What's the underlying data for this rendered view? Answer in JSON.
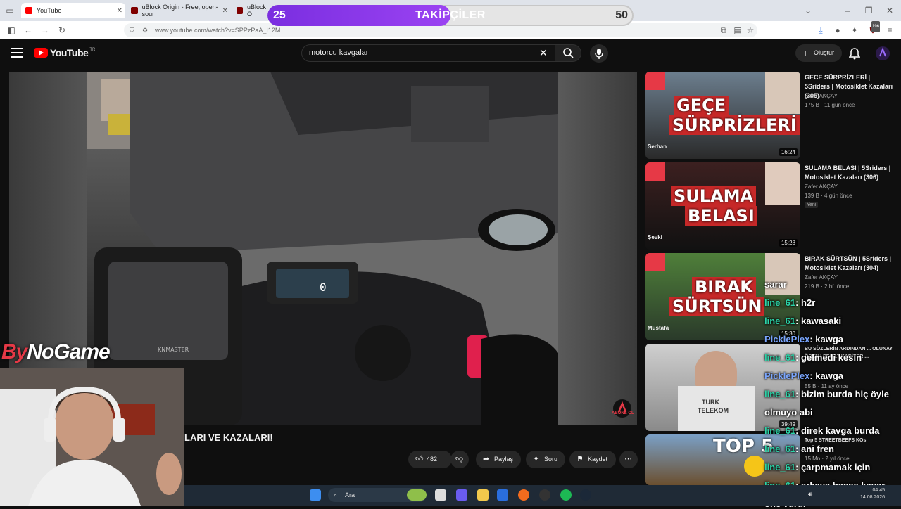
{
  "browser": {
    "tabs": [
      {
        "title": "YouTube",
        "color": "#ff0000"
      },
      {
        "title": "uBlock Origin - Free, open-sour",
        "color": "#800000"
      },
      {
        "title": "uBlock O",
        "color": "#800000"
      }
    ],
    "url": "www.youtube.com/watch?v=SPPzPaA_I12M",
    "extension_badge": "196"
  },
  "overlay": {
    "followers": {
      "label": "TAKİPÇİLER",
      "min": "25",
      "max": "50",
      "progress": 0.5
    }
  },
  "youtube": {
    "logo": "YouTube",
    "logo_sup": "TR",
    "search": {
      "query": "motorcu kavgalar"
    },
    "create_label": "Oluştur"
  },
  "video": {
    "title_visible": "LARI VE KAZALARI!",
    "actions": {
      "likes": "482",
      "share": "Paylaş",
      "ask": "Soru",
      "save": "Kaydet"
    },
    "subscribe_watermark": "ABONE OL"
  },
  "recommendations": [
    {
      "title": "GECE SÜRPRİZLERİ | 5Sriders | Motosiklet Kazaları (305)",
      "channel": "Zafer AKÇAY",
      "meta": "175 B · 11 gün önce",
      "duration": "16:24",
      "thumb_text": [
        "GEÇE",
        "SÜRPRİZLERİ"
      ],
      "thumb_name": "Serhan",
      "badge": ""
    },
    {
      "title": "SULAMA BELASI | 5Sriders | Motosiklet Kazaları (306)",
      "channel": "Zafer AKÇAY",
      "meta": "139 B · 4 gün önce",
      "duration": "15:28",
      "thumb_text": [
        "SULAMA",
        "BELASI"
      ],
      "thumb_name": "Şevki",
      "badge": "Yeni"
    },
    {
      "title": "BIRAK SÜRTSÜN | 5Sriders | Motosiklet Kazaları (304)",
      "channel": "Zafer AKÇAY",
      "meta": "219 B · 2 hf. önce",
      "duration": "15:30",
      "thumb_text": [
        "BIRAK",
        "SÜRTSÜN"
      ],
      "thumb_name": "Mustafa",
      "badge": ""
    },
    {
      "title": "BU SÖZLERİN ARDINDAN ... OLUNAY ÖREN | PES 17 KARİYER ...",
      "channel": "",
      "meta": "55 B · 11 ay önce",
      "duration": "39:49",
      "thumb_text": [
        "TÜRK",
        "TELEKOM"
      ],
      "thumb_name": "",
      "badge": ""
    },
    {
      "title": "Top 5 STREETBEEFS KOs",
      "channel": "",
      "meta": "15 Mn · 2 yıl önce",
      "duration": "",
      "thumb_text": [
        "TOP 5"
      ],
      "thumb_name": "",
      "badge": ""
    }
  ],
  "chat": [
    {
      "user": "",
      "msg": "sarar"
    },
    {
      "user": "line_61",
      "msg": ": h2r"
    },
    {
      "user": "line_61",
      "msg": ": kawasaki"
    },
    {
      "user": "PicklePlex",
      "msg": ": kawga"
    },
    {
      "user": "line_61",
      "msg": ": gelmedi kesin"
    },
    {
      "user": "PicklePlex",
      "msg": ": kawga"
    },
    {
      "user": "line_61",
      "msg": ": bizim burda hiç öyle"
    },
    {
      "user": "",
      "msg": "olmuyo abi"
    },
    {
      "user": "line_61",
      "msg": ": direk kavga burda"
    },
    {
      "user": "line_61",
      "msg": ": ani fren"
    },
    {
      "user": "line_61",
      "msg": ": çarpmamak için"
    },
    {
      "user": "line_61",
      "msg": ": arkaya bassa kayar"
    },
    {
      "user": "",
      "msg": "öne vurur"
    }
  ],
  "streamer": {
    "brand_a": "By",
    "brand_b": "NoGame"
  },
  "taskbar": {
    "search_placeholder": "Ara",
    "time": "04:45",
    "date": "14.08.2026"
  },
  "colors": {
    "accent_purple": "#8a3ef0",
    "youtube_red": "#ff0000",
    "chat_user": "#2bd4a8",
    "chat_user2": "#7aa6ff"
  }
}
